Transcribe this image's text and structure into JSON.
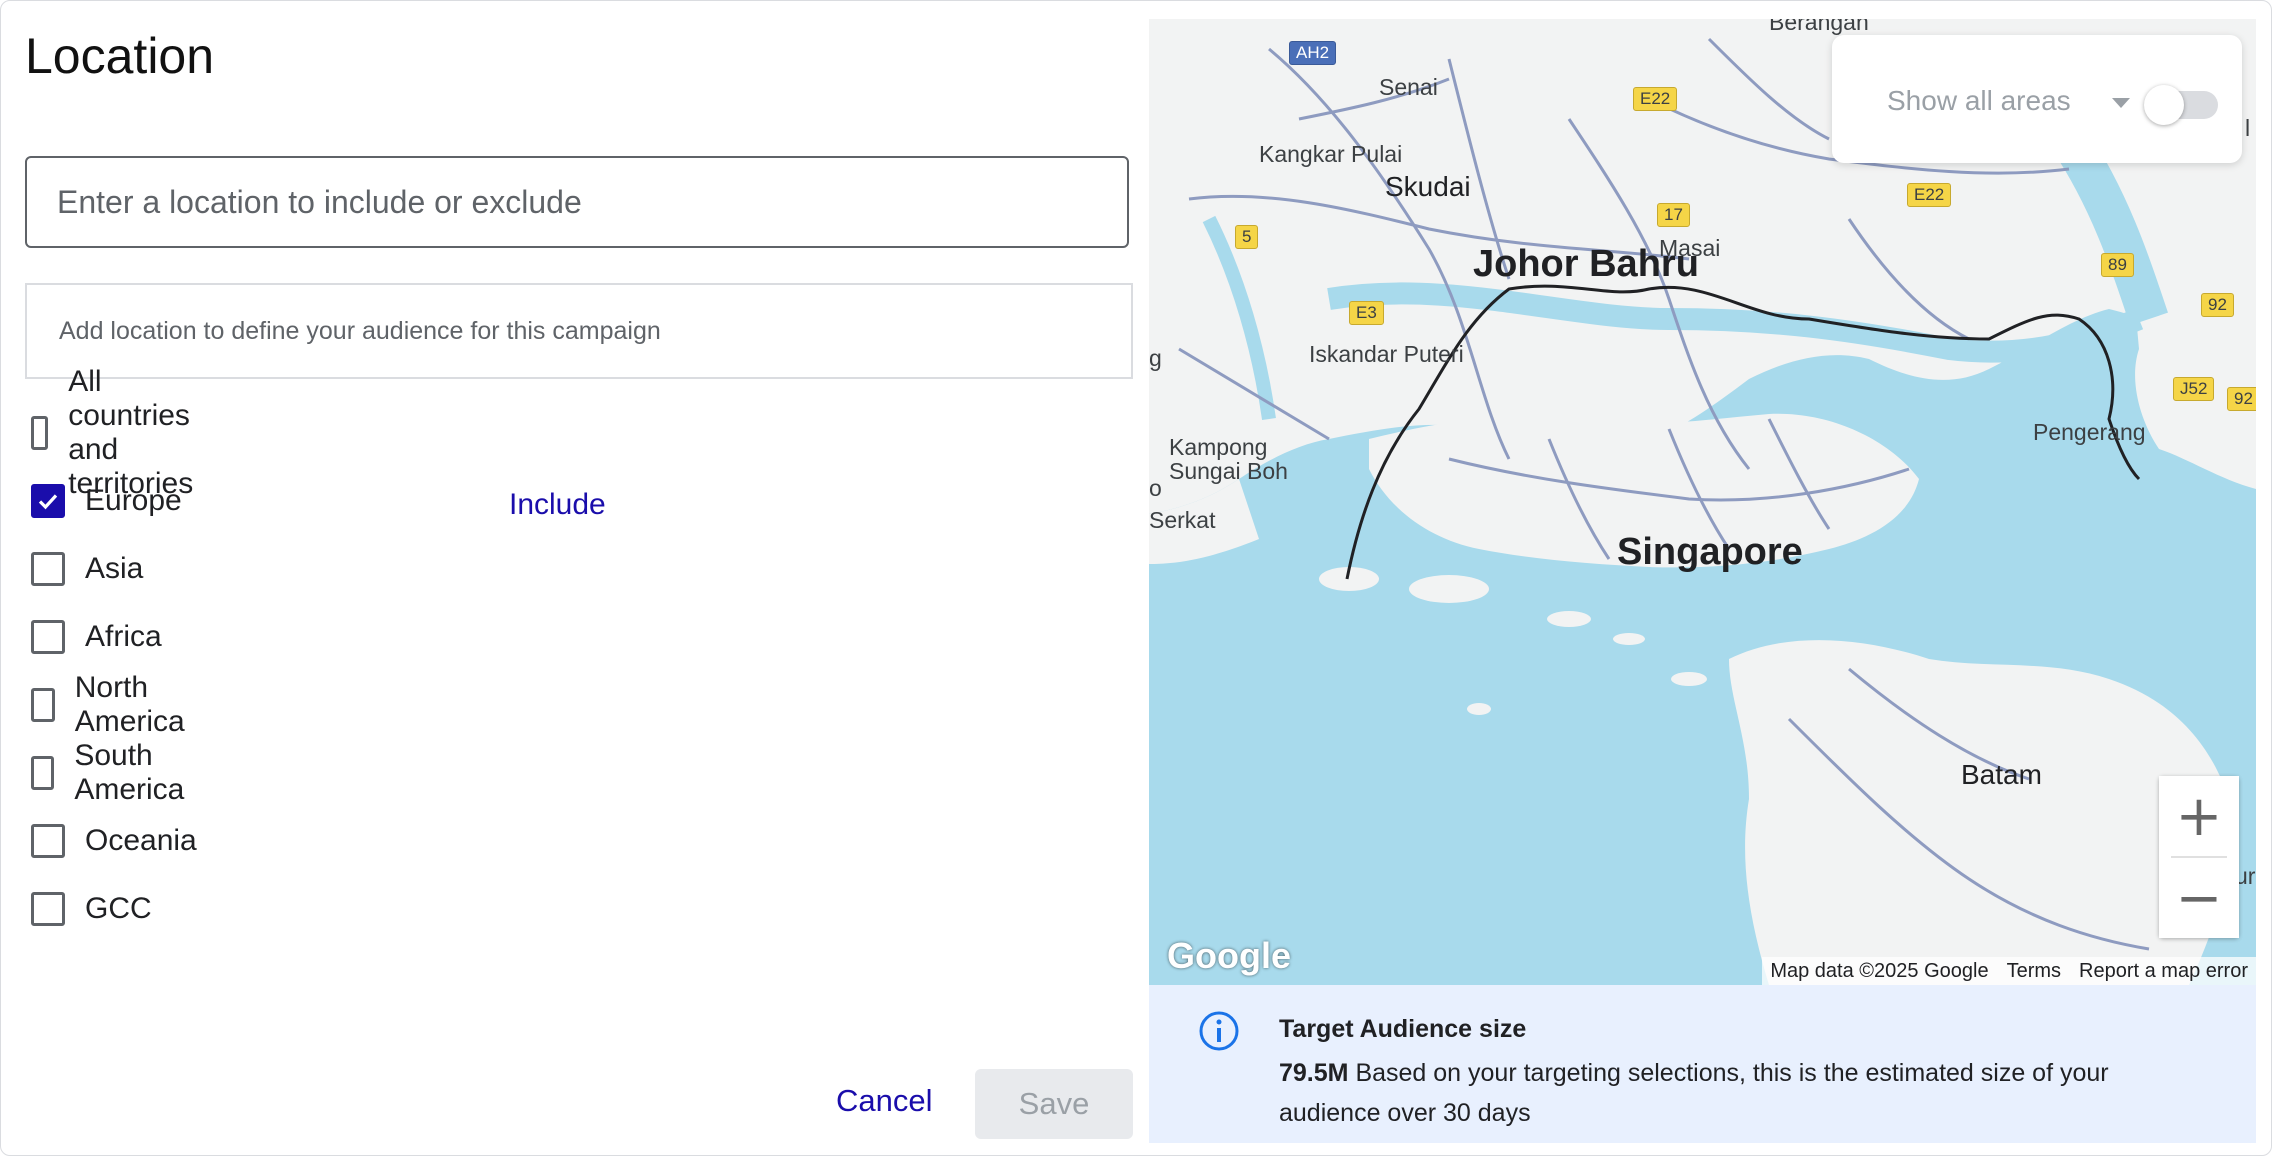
{
  "dialog": {
    "title": "Location"
  },
  "search": {
    "placeholder": "Enter a location to include or exclude",
    "value": ""
  },
  "hint": "Add location to define your audience for this campaign",
  "regions": [
    {
      "label": "All countries and territories",
      "checked": false
    },
    {
      "label": "Europe",
      "checked": true,
      "status": "Include"
    },
    {
      "label": "Asia",
      "checked": false
    },
    {
      "label": "Africa",
      "checked": false
    },
    {
      "label": "North America",
      "checked": false
    },
    {
      "label": "South America",
      "checked": false
    },
    {
      "label": "Oceania",
      "checked": false
    },
    {
      "label": "GCC",
      "checked": false
    }
  ],
  "actions": {
    "cancel": "Cancel",
    "save": "Save"
  },
  "map": {
    "show_areas": {
      "label": "Show all areas",
      "toggle_on": false
    },
    "labels": {
      "berangan": "Berangan",
      "senai": "Senai",
      "kangkar_pulai": "Kangkar Pulai",
      "skudai": "Skudai",
      "masai": "Masai",
      "johor_bahru": "Johor Bahru",
      "iskandar_puteri": "Iskandar Puteri",
      "kampong_sungai_boh": "Kampong\nSungai Boh",
      "serkat": "Serkat",
      "singapore": "Singapore",
      "pengerang": "Pengerang",
      "batam": "Batam",
      "edge_g": "g",
      "edge_o": "o",
      "edge_ur": "ur",
      "edge_l": "l"
    },
    "shields": {
      "ah2": "AH2",
      "e22a": "E22",
      "e22b": "E22",
      "r17": "17",
      "r5": "5",
      "e3": "E3",
      "r89": "89",
      "r92a": "92",
      "j52": "J52",
      "r92b": "92"
    },
    "logo": "Google",
    "attribution": {
      "data": "Map data ©2025 Google",
      "terms": "Terms",
      "report": "Report a map error"
    },
    "zoom_in": "+",
    "zoom_out": "−"
  },
  "audience": {
    "title": "Target Audience size",
    "size": "79.5M",
    "description": "Based on your targeting selections, this is the estimated size of your audience over 30 days"
  },
  "colors": {
    "accent": "#1a0dab",
    "water": "#a8daec",
    "land": "#f2f3f3",
    "road": "#8e9bc0",
    "panel": "#e8f0fe"
  }
}
